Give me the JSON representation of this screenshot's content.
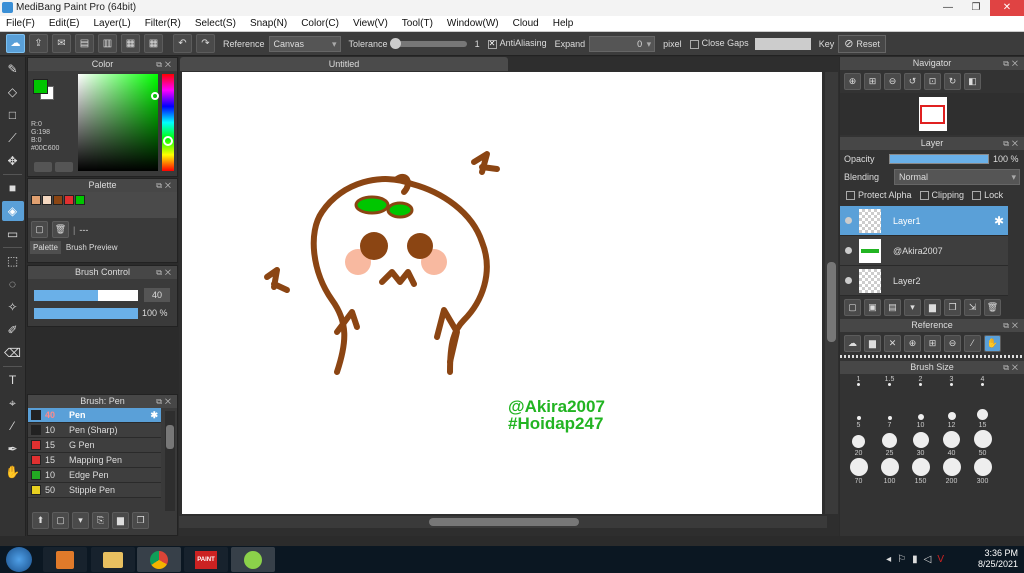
{
  "window": {
    "title": "MediBang Paint Pro (64bit)",
    "min": "—",
    "max": "❐",
    "close": "✕"
  },
  "menu": [
    "File(F)",
    "Edit(E)",
    "Layer(L)",
    "Filter(R)",
    "Select(S)",
    "Snap(N)",
    "Color(C)",
    "View(V)",
    "Tool(T)",
    "Window(W)",
    "Cloud",
    "Help"
  ],
  "toolbar": {
    "reference_label": "Reference",
    "reference_value": "Canvas",
    "tolerance_label": "Tolerance",
    "tolerance_value": "1",
    "tolerance_level": 0.0,
    "antialiasing_label": "AntiAliasing",
    "expand_label": "Expand",
    "expand_value": "0",
    "pixel_label": "pixel",
    "closegaps_label": "Close Gaps",
    "key_label": "Key",
    "reset_label": "Reset"
  },
  "color_panel": {
    "title": "Color",
    "r": "R:0",
    "g": "G:198",
    "b": "B:0",
    "hex": "#00C600",
    "fg": "#00c600",
    "bg": "#ffffff"
  },
  "palette_panel": {
    "title": "Palette",
    "colors": [
      "#e0a070",
      "#f4d7c0",
      "#8b4513",
      "#e03030",
      "#00c600"
    ],
    "name": "---",
    "tab_palette": "Palette",
    "tab_brush_preview": "Brush Preview"
  },
  "brush_control": {
    "title": "Brush Control",
    "size": "40",
    "size_level": 0.62,
    "opacity": "100 %",
    "opacity_level": 1.0
  },
  "brush_list": {
    "title": "Brush: Pen",
    "items": [
      {
        "size": "40",
        "name": "Pen",
        "color": "#222222"
      },
      {
        "size": "10",
        "name": "Pen (Sharp)",
        "color": "#222222"
      },
      {
        "size": "15",
        "name": "G Pen",
        "color": "#e03030"
      },
      {
        "size": "15",
        "name": "Mapping Pen",
        "color": "#e03030"
      },
      {
        "size": "10",
        "name": "Edge Pen",
        "color": "#22aa22"
      },
      {
        "size": "50",
        "name": "Stipple Pen",
        "color": "#e8d020"
      }
    ]
  },
  "canvas": {
    "tab": "Untitled",
    "watermark_line1": "@Akira2007",
    "watermark_line2": "#Hoidap247",
    "ink": "#8b4513",
    "accent": "#00c600"
  },
  "navigator": {
    "title": "Navigator"
  },
  "layer_panel": {
    "title": "Layer",
    "opacity_label": "Opacity",
    "opacity_value": "100 %",
    "blending_label": "Blending",
    "blending_value": "Normal",
    "protect_alpha": "Protect Alpha",
    "clipping": "Clipping",
    "lock": "Lock",
    "layers": [
      {
        "name": "Layer1"
      },
      {
        "name": "@Akira2007"
      },
      {
        "name": "Layer2"
      }
    ]
  },
  "reference_panel": {
    "title": "Reference"
  },
  "brush_size": {
    "title": "Brush Size",
    "rows": [
      [
        "1",
        "1.5",
        "2",
        "3",
        "4"
      ],
      [
        "5",
        "7",
        "10",
        "12",
        "15"
      ],
      [
        "20",
        "25",
        "30",
        "40",
        "50"
      ],
      [
        "70",
        "100",
        "150",
        "200",
        "300"
      ]
    ]
  },
  "taskbar": {
    "time": "3:36 PM",
    "date": "8/25/2021",
    "paint_label": "PAINT"
  }
}
